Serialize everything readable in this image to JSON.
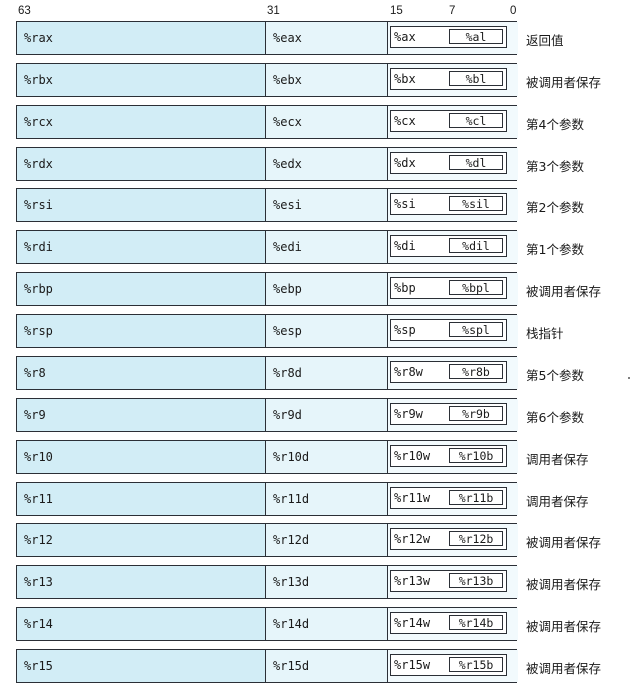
{
  "bit_positions": [
    "63",
    "31",
    "15",
    "7",
    "0"
  ],
  "registers": [
    {
      "r64": "%rax",
      "r32": "%eax",
      "r16": "%ax",
      "r8": "%al",
      "role": "返回值"
    },
    {
      "r64": "%rbx",
      "r32": "%ebx",
      "r16": "%bx",
      "r8": "%bl",
      "role": "被调用者保存"
    },
    {
      "r64": "%rcx",
      "r32": "%ecx",
      "r16": "%cx",
      "r8": "%cl",
      "role": "第4个参数"
    },
    {
      "r64": "%rdx",
      "r32": "%edx",
      "r16": "%dx",
      "r8": "%dl",
      "role": "第3个参数"
    },
    {
      "r64": "%rsi",
      "r32": "%esi",
      "r16": "%si",
      "r8": "%sil",
      "role": "第2个参数"
    },
    {
      "r64": "%rdi",
      "r32": "%edi",
      "r16": "%di",
      "r8": "%dil",
      "role": "第1个参数"
    },
    {
      "r64": "%rbp",
      "r32": "%ebp",
      "r16": "%bp",
      "r8": "%bpl",
      "role": "被调用者保存"
    },
    {
      "r64": "%rsp",
      "r32": "%esp",
      "r16": "%sp",
      "r8": "%spl",
      "role": "栈指针"
    },
    {
      "r64": "%r8",
      "r32": "%r8d",
      "r16": "%r8w",
      "r8": "%r8b",
      "role": "第5个参数"
    },
    {
      "r64": "%r9",
      "r32": "%r9d",
      "r16": "%r9w",
      "r8": "%r9b",
      "role": "第6个参数"
    },
    {
      "r64": "%r10",
      "r32": "%r10d",
      "r16": "%r10w",
      "r8": "%r10b",
      "role": "调用者保存"
    },
    {
      "r64": "%r11",
      "r32": "%r11d",
      "r16": "%r11w",
      "r8": "%r11b",
      "role": "调用者保存"
    },
    {
      "r64": "%r12",
      "r32": "%r12d",
      "r16": "%r12w",
      "r8": "%r12b",
      "role": "被调用者保存"
    },
    {
      "r64": "%r13",
      "r32": "%r13d",
      "r16": "%r13w",
      "r8": "%r13b",
      "role": "被调用者保存"
    },
    {
      "r64": "%r14",
      "r32": "%r14d",
      "r16": "%r14w",
      "r8": "%r14b",
      "role": "被调用者保存"
    },
    {
      "r64": "%r15",
      "r32": "%r15d",
      "r16": "%r15w",
      "r8": "%r15b",
      "role": "被调用者保存"
    }
  ]
}
